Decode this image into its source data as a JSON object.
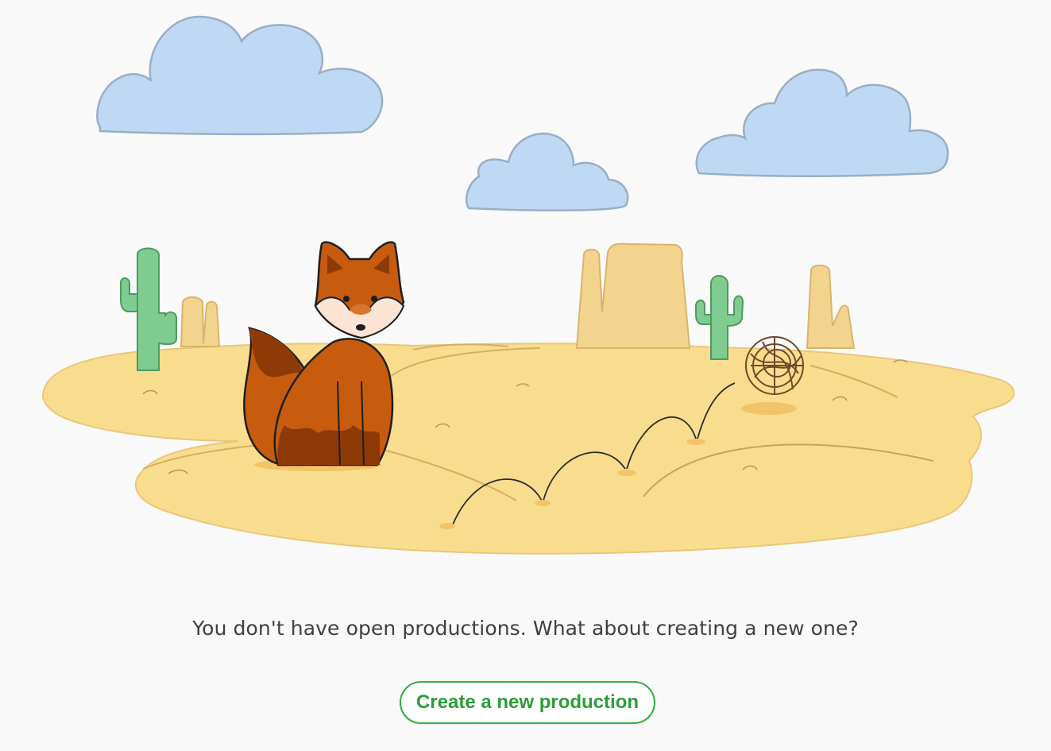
{
  "empty_state": {
    "message": "You don't have open productions. What about creating a new one?",
    "create_button_label": "Create a new production"
  },
  "colors": {
    "background": "#f9f9f9",
    "accent": "#2fae3c",
    "message_text": "#3f3f3f"
  },
  "illustration": {
    "icon_names": [
      "cloud-icon",
      "cactus-icon",
      "mesa-rock-icon",
      "fox-icon",
      "tumbleweed-icon"
    ]
  }
}
